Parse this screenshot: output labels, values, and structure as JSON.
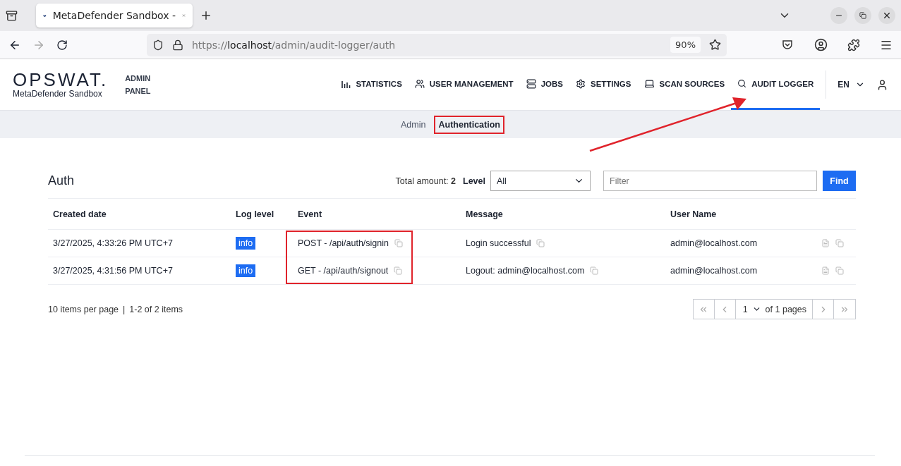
{
  "browser": {
    "tab_title": "MetaDefender Sandbox -",
    "url_scheme": "https://",
    "url_host": "localhost",
    "url_path": "/admin/audit-logger/auth",
    "zoom": "90%"
  },
  "header": {
    "brand": "OPSWAT.",
    "product": "MetaDefender Sandbox",
    "panel_label": "ADMIN PANEL",
    "nav": [
      {
        "kind": "chart",
        "label": "STATISTICS",
        "selected": false
      },
      {
        "kind": "users",
        "label": "USER MANAGEMENT",
        "selected": false
      },
      {
        "kind": "server",
        "label": "JOBS",
        "selected": false
      },
      {
        "kind": "gear",
        "label": "SETTINGS",
        "selected": false
      },
      {
        "kind": "laptop",
        "label": "SCAN SOURCES",
        "selected": false
      },
      {
        "kind": "search",
        "label": "AUDIT LOGGER",
        "selected": true
      }
    ],
    "language": "EN"
  },
  "subnav": [
    {
      "label": "Admin",
      "selected": false,
      "highlighted": false
    },
    {
      "label": "Authentication",
      "selected": true,
      "highlighted": true
    }
  ],
  "section": {
    "title": "Auth",
    "total_label": "Total amount:",
    "total": "2",
    "level_label": "Level",
    "level_value": "All",
    "filter_placeholder": "Filter",
    "find_button": "Find"
  },
  "table": {
    "columns": [
      "Created date",
      "Log level",
      "Event",
      "Message",
      "User Name"
    ],
    "rows": [
      {
        "created": "3/27/2025, 4:33:26 PM UTC+7",
        "level": "info",
        "event": "POST - /api/auth/signin",
        "message": "Login successful",
        "user": "admin@localhost.com"
      },
      {
        "created": "3/27/2025, 4:31:56 PM UTC+7",
        "level": "info",
        "event": "GET - /api/auth/signout",
        "message": "Logout: admin@localhost.com",
        "user": "admin@localhost.com"
      }
    ],
    "events_highlighted": true
  },
  "footer": {
    "per_page": "10 items per page",
    "separator": "|",
    "range": "1-2 of 2 items",
    "page": "1",
    "page_total": "of 1 pages"
  },
  "annotation_arrow": true
}
